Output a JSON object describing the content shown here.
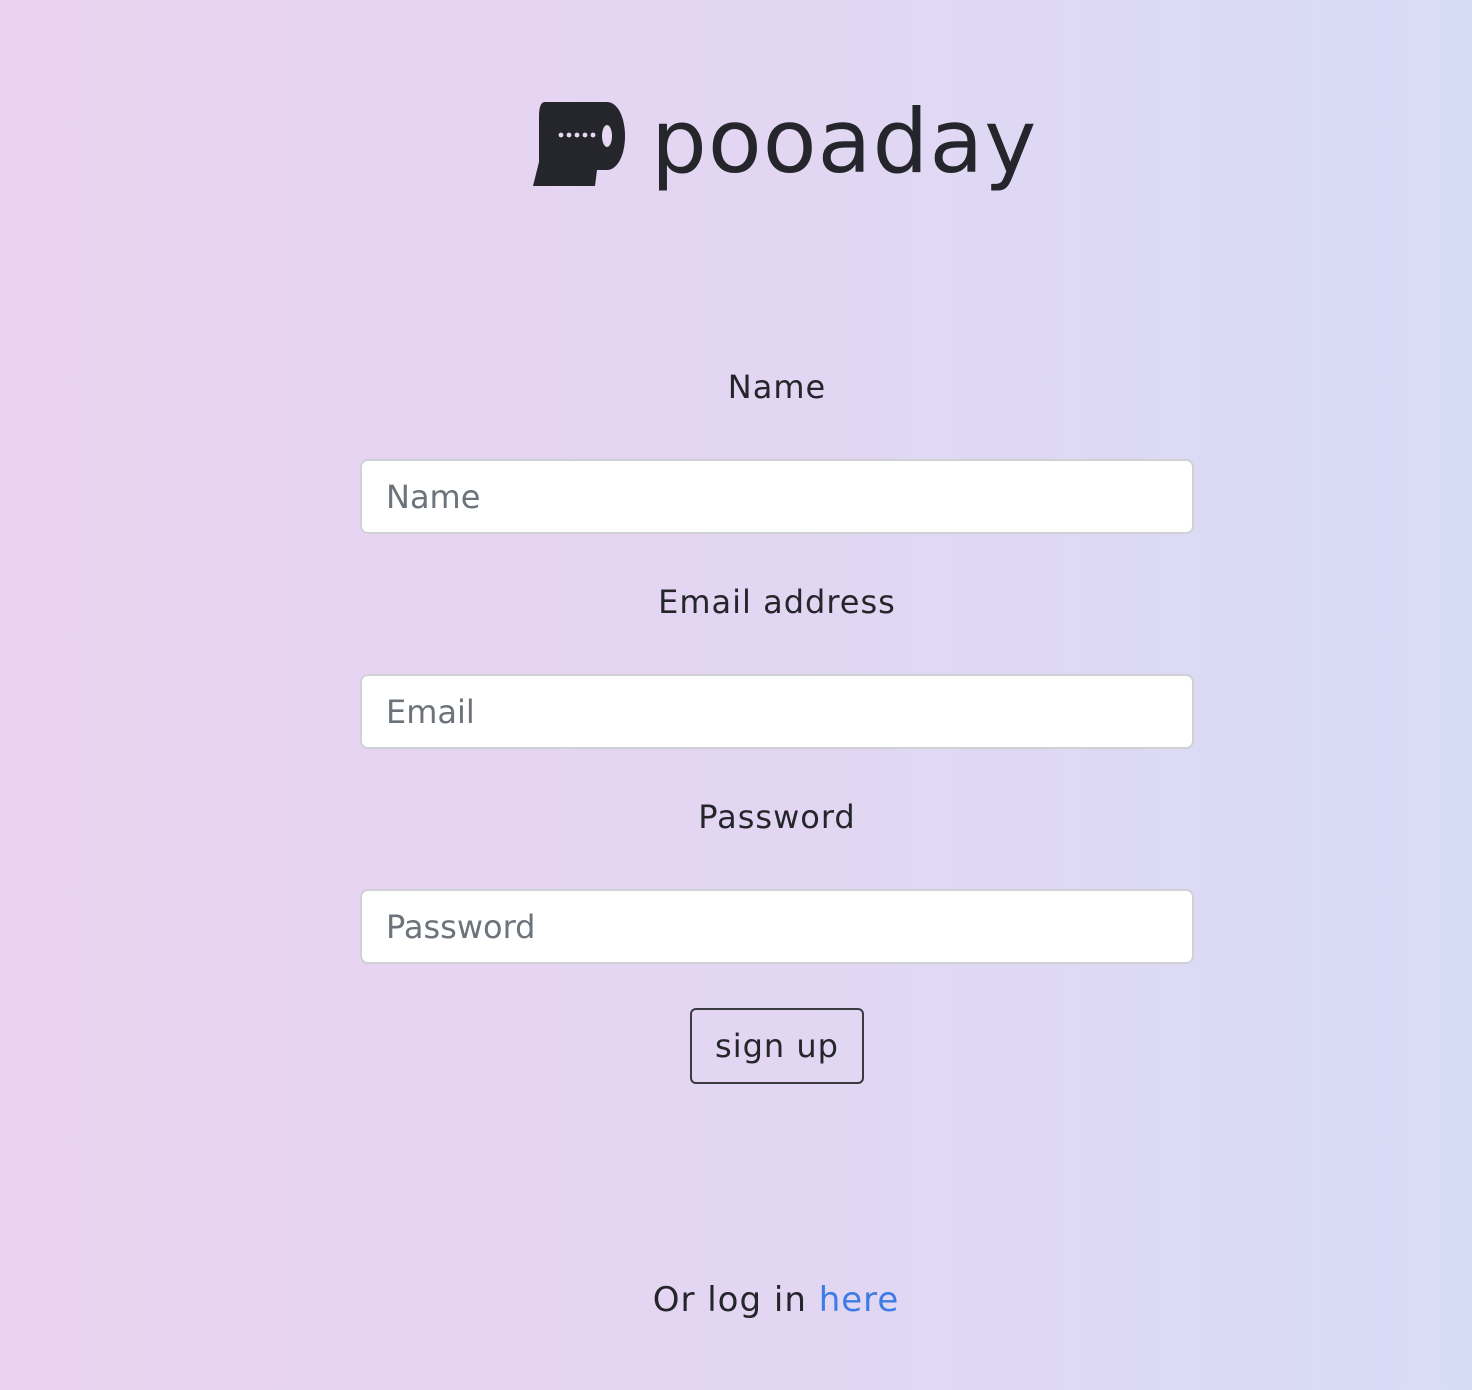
{
  "brand": {
    "name": "pooaday",
    "logo_icon": "toilet-paper-roll-icon"
  },
  "form": {
    "name_label": "Name",
    "name_placeholder": "Name",
    "email_label": "Email address",
    "email_placeholder": "Email",
    "password_label": "Password",
    "password_placeholder": "Password",
    "signup_button": "sign up"
  },
  "login": {
    "prefix": "Or log in ",
    "link_text": "here"
  },
  "colors": {
    "text": "#25262b",
    "link": "#3d7be6",
    "input_border": "#cfd1d6",
    "background_start": "#ead3f0",
    "background_end": "#d7dcf5"
  }
}
